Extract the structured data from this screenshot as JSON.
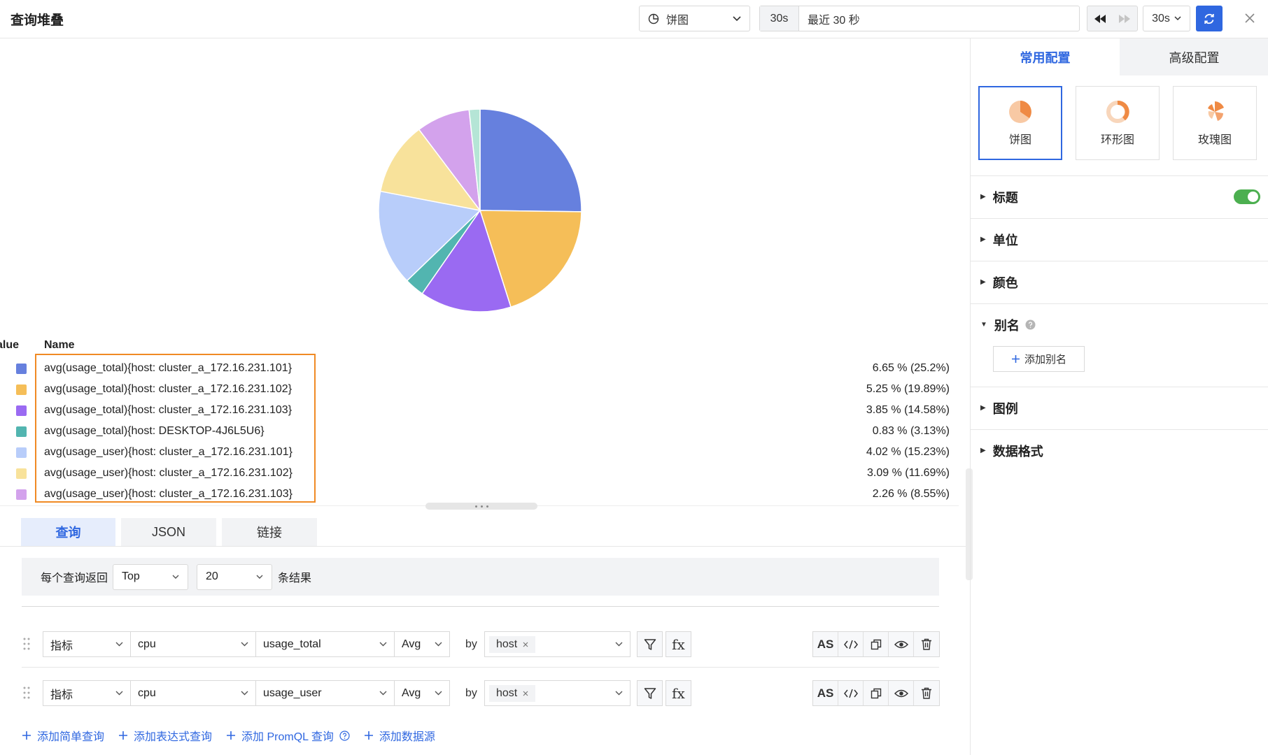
{
  "header": {
    "title": "查询堆叠",
    "chart_type_label": "饼图",
    "time_short": "30s",
    "time_range": "最近 30 秒",
    "refresh_interval": "30s"
  },
  "chart_data": {
    "type": "pie",
    "columns": [
      "Name",
      "Value"
    ],
    "series": [
      {
        "name": "avg(usage_total){host: cluster_a_172.16.231.101}",
        "value": 6.65,
        "percent": 25.2,
        "display": "6.65 % (25.2%)",
        "color": "#6680de"
      },
      {
        "name": "avg(usage_total){host: cluster_a_172.16.231.102}",
        "value": 5.25,
        "percent": 19.89,
        "display": "5.25 % (19.89%)",
        "color": "#f5be58"
      },
      {
        "name": "avg(usage_total){host: cluster_a_172.16.231.103}",
        "value": 3.85,
        "percent": 14.58,
        "display": "3.85 % (14.58%)",
        "color": "#9a6af2"
      },
      {
        "name": "avg(usage_total){host: DESKTOP-4J6L5U6}",
        "value": 0.83,
        "percent": 3.13,
        "display": "0.83 % (3.13%)",
        "color": "#52b5b0"
      },
      {
        "name": "avg(usage_user){host: cluster_a_172.16.231.101}",
        "value": 4.02,
        "percent": 15.23,
        "display": "4.02 % (15.23%)",
        "color": "#b8cdfa"
      },
      {
        "name": "avg(usage_user){host: cluster_a_172.16.231.102}",
        "value": 3.09,
        "percent": 11.69,
        "display": "3.09 % (11.69%)",
        "color": "#f8e29b"
      },
      {
        "name": "avg(usage_user){host: cluster_a_172.16.231.103}",
        "value": 2.26,
        "percent": 8.55,
        "display": "2.26 % (8.55%)",
        "color": "#d3a2ec"
      },
      {
        "name": "",
        "value": 0.45,
        "percent": 1.73,
        "display": "",
        "color": "#b5e5d6"
      }
    ]
  },
  "editor": {
    "tabs": [
      "查询",
      "JSON",
      "链接"
    ],
    "active_tab": "查询",
    "return_label": "每个查询返回",
    "order": "Top",
    "limit": "20",
    "suffix": "条结果",
    "queries": [
      {
        "type": "指标",
        "measurement": "cpu",
        "field": "usage_total",
        "agg": "Avg",
        "by": "by",
        "group_tag": "host",
        "fx": "fx",
        "as": "AS"
      },
      {
        "type": "指标",
        "measurement": "cpu",
        "field": "usage_user",
        "agg": "Avg",
        "by": "by",
        "group_tag": "host",
        "fx": "fx",
        "as": "AS"
      }
    ],
    "add_links": [
      "添加简单查询",
      "添加表达式查询",
      "添加 PromQL 查询",
      "添加数据源"
    ]
  },
  "settings": {
    "tabs": [
      "常用配置",
      "高级配置"
    ],
    "chart_types": [
      "饼图",
      "环形图",
      "玫瑰图"
    ],
    "sections": [
      "标题",
      "单位",
      "颜色",
      "别名",
      "图例",
      "数据格式"
    ],
    "add_alias": "添加别名",
    "title_toggle": true
  },
  "colors": {
    "accent": "#2f67e0",
    "highlight_border": "#f08a24",
    "toggle_on": "#4caf50"
  }
}
